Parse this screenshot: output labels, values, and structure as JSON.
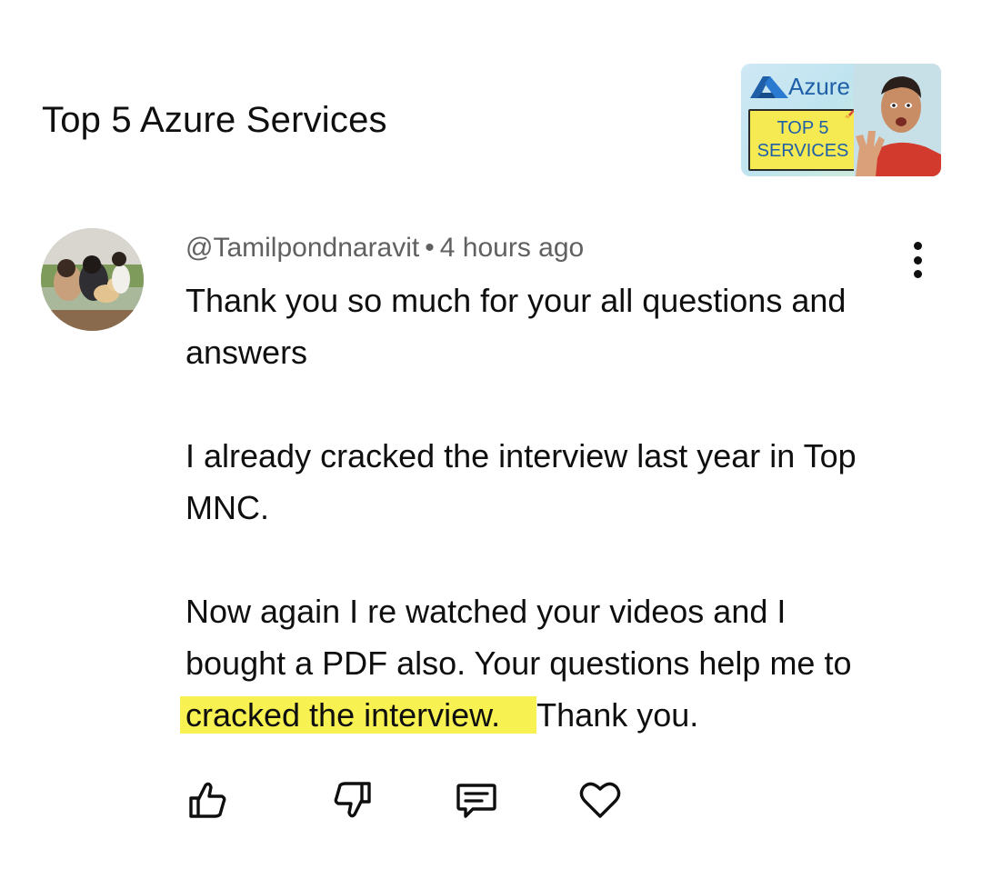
{
  "header": {
    "video_title": "Top 5 Azure Services",
    "thumbnail": {
      "brand": "Azure",
      "badge_line1": "TOP 5",
      "badge_line2": "SERVICES"
    }
  },
  "comment": {
    "author": "@Tamilpondnaravit",
    "separator": "•",
    "timestamp": "4 hours ago",
    "paragraph1_line1": "Thank you so much for your all questions and",
    "paragraph1_line2": "answers",
    "paragraph2_line1": "I already cracked the interview last year in Top",
    "paragraph2_line2": "MNC.",
    "paragraph3_line1": "Now again I re watched your videos and I",
    "paragraph3_line2": "bought a PDF also. Your questions help me to",
    "paragraph3_highlight": "cracked the interview. ",
    "paragraph3_tail": "Thank you."
  },
  "actions": {
    "icons": [
      "thumbs-up-icon",
      "thumbs-down-icon",
      "reply-icon",
      "heart-icon"
    ]
  },
  "colors": {
    "highlight": "#f7f252",
    "meta_text": "#606060",
    "text": "#0f0f0f",
    "azure_blue": "#1f5fa8"
  }
}
